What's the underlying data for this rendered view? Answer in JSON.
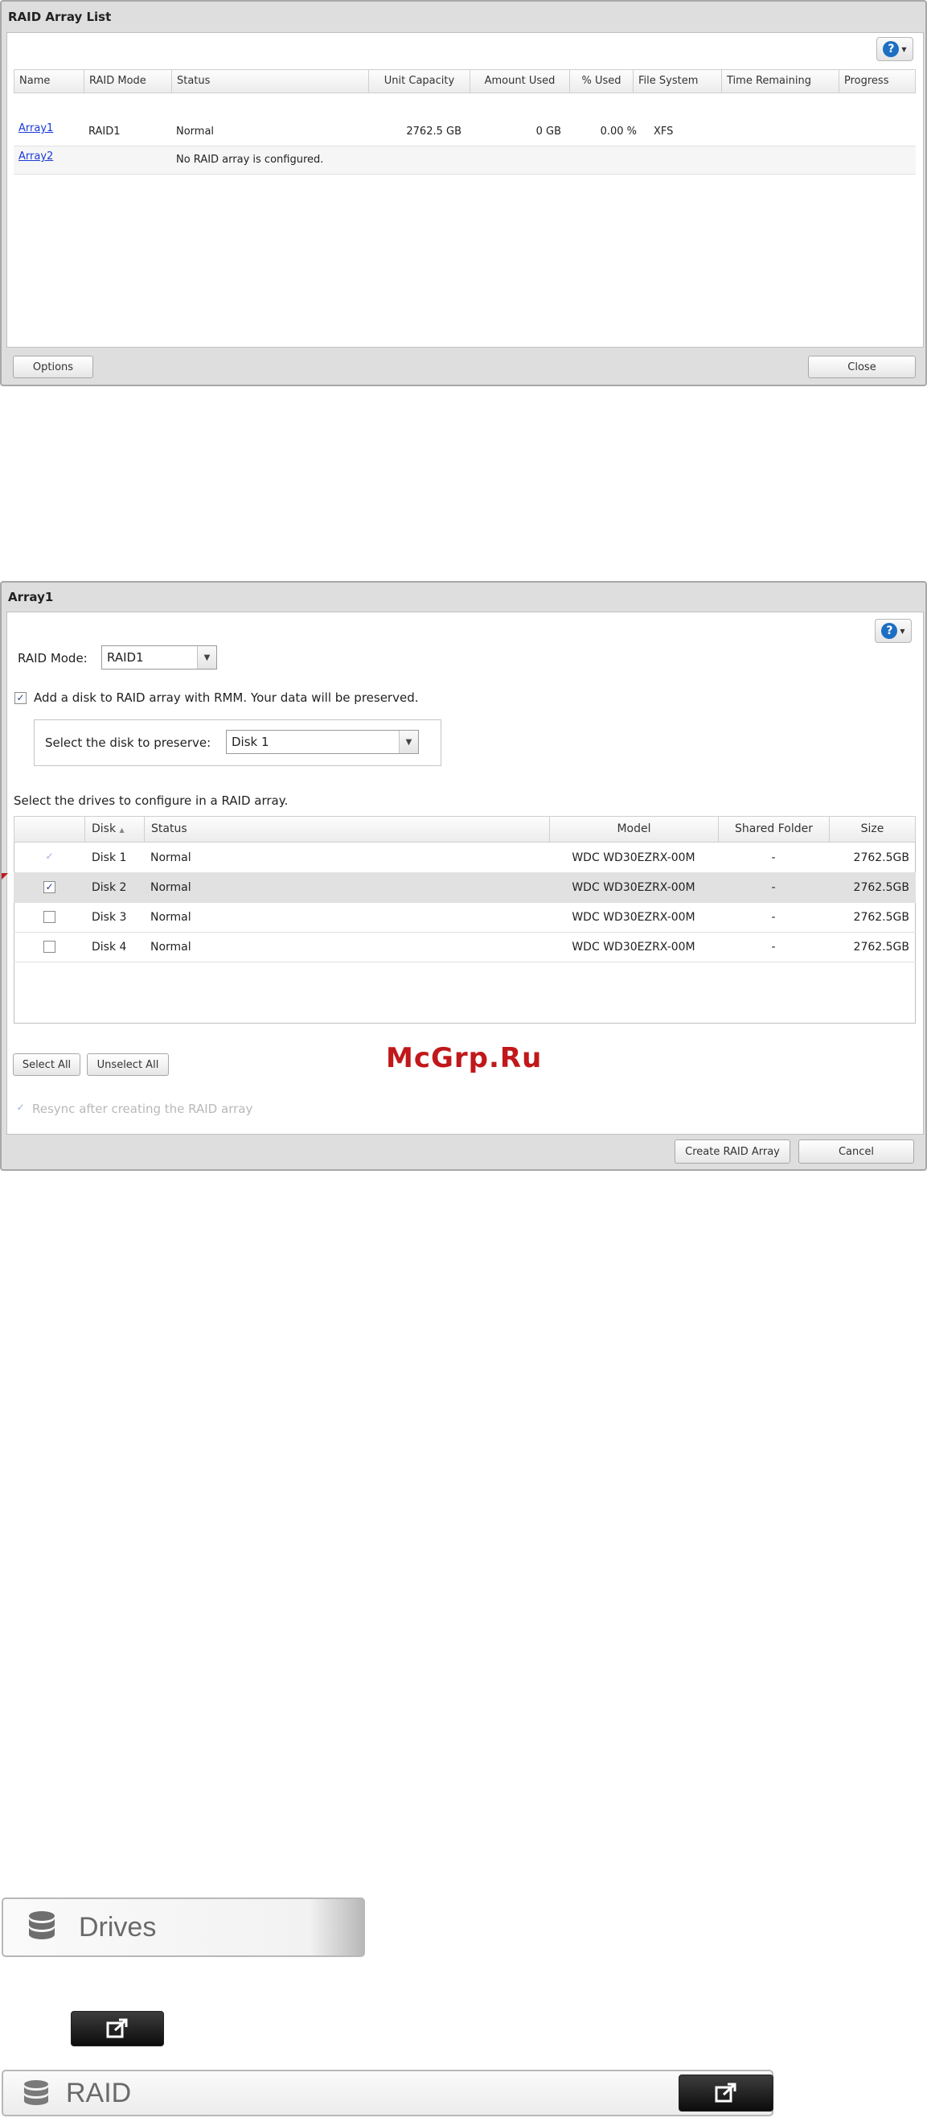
{
  "raid_list": {
    "title": "RAID Array List",
    "columns": [
      "Name",
      "RAID Mode",
      "Status",
      "Unit Capacity",
      "Amount Used",
      "% Used",
      "File System",
      "Time Remaining",
      "Progress"
    ],
    "rows": [
      {
        "name": "Array1",
        "mode": "RAID1",
        "status": "Normal",
        "capacity": "2762.5 GB",
        "used": "0 GB",
        "pct": "0.00 %",
        "fs": "XFS",
        "remaining": "",
        "progress": ""
      },
      {
        "name": "Array2",
        "mode": "",
        "status": "No RAID array is configured.",
        "capacity": "",
        "used": "",
        "pct": "",
        "fs": "",
        "remaining": "",
        "progress": ""
      }
    ],
    "options_label": "Options",
    "close_label": "Close"
  },
  "array_dialog": {
    "title": "Array1",
    "raid_mode_label": "RAID Mode:",
    "raid_mode_value": "RAID1",
    "rmm_label": "Add a disk to RAID array with RMM. Your data will be preserved.",
    "rmm_checked": true,
    "preserve_label": "Select the disk to preserve:",
    "preserve_value": "Disk 1",
    "drives_label": "Select the drives to configure in a RAID array.",
    "columns": {
      "disk": "Disk",
      "status": "Status",
      "model": "Model",
      "shared": "Shared Folder",
      "size": "Size"
    },
    "disks": [
      {
        "disk": "Disk 1",
        "status": "Normal",
        "model": "WDC WD30EZRX-00M",
        "shared": "-",
        "size": "2762.5GB",
        "checked": true,
        "disabled": true,
        "selected": false
      },
      {
        "disk": "Disk 2",
        "status": "Normal",
        "model": "WDC WD30EZRX-00M",
        "shared": "-",
        "size": "2762.5GB",
        "checked": true,
        "disabled": false,
        "selected": true
      },
      {
        "disk": "Disk 3",
        "status": "Normal",
        "model": "WDC WD30EZRX-00M",
        "shared": "-",
        "size": "2762.5GB",
        "checked": false,
        "disabled": false,
        "selected": false
      },
      {
        "disk": "Disk 4",
        "status": "Normal",
        "model": "WDC WD30EZRX-00M",
        "shared": "-",
        "size": "2762.5GB",
        "checked": false,
        "disabled": false,
        "selected": false
      }
    ],
    "select_all_label": "Select All",
    "unselect_all_label": "Unselect All",
    "resync_label": "Resync after creating the RAID array",
    "create_label": "Create RAID Array",
    "cancel_label": "Cancel"
  },
  "watermark": "McGrp.Ru",
  "drives_nav": {
    "label": "Drives",
    "icon": "database-icon"
  },
  "raid_nav": {
    "label": "RAID",
    "icon": "database-icon",
    "open_icon": "external-open-icon"
  },
  "colors": {
    "help": "#1d6fc4",
    "link": "#1a3ad6",
    "watermark": "#c0181b"
  }
}
